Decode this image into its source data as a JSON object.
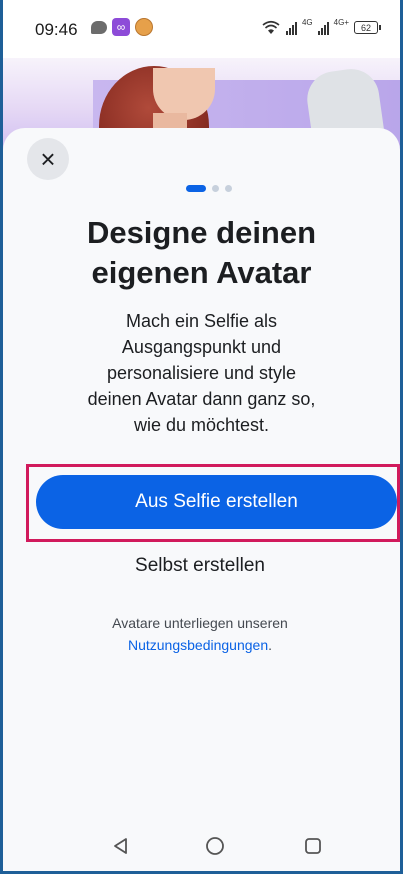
{
  "status_bar": {
    "time": "09:46",
    "battery": "62",
    "net_1": "4G",
    "net_2": "4G+"
  },
  "onboarding": {
    "title_line1": "Designe deinen",
    "title_line2": "eigenen Avatar",
    "description_lines": [
      "Mach ein Selfie als",
      "Ausgangspunkt und",
      "personalisiere und style",
      "deinen Avatar dann ganz so,",
      "wie du möchtest."
    ],
    "page_indicator": {
      "total": 3,
      "active": 1
    },
    "primary_button": "Aus Selfie erstellen",
    "secondary_button": "Selbst erstellen",
    "terms_text": "Avatare unterliegen unseren",
    "terms_link": "Nutzungsbedingungen",
    "terms_period": ".",
    "close_icon": "close-icon"
  },
  "colors": {
    "primary": "#0b63e5",
    "highlight": "#d11a5c",
    "frame": "#1e5f98"
  }
}
